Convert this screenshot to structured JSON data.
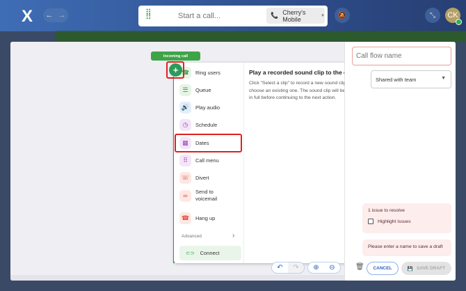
{
  "header": {
    "logo": "X",
    "back": "←",
    "forward": "→",
    "call_placeholder": "Start a call...",
    "line_label": "Cherry's Mobile",
    "avatar_initials": "CK"
  },
  "canvas": {
    "incoming_call": "Incoming call",
    "add": "+"
  },
  "menu": {
    "items": [
      {
        "label": "Ring users",
        "icon": "ring-users-icon",
        "glyph": "☎",
        "bg": "#e6f4e6",
        "color": "#2e9a4a"
      },
      {
        "label": "Queue",
        "icon": "queue-icon",
        "glyph": "☰",
        "bg": "#e6f4e6",
        "color": "#2e9a4a"
      },
      {
        "label": "Play audio",
        "icon": "speaker-icon",
        "glyph": "🔊",
        "bg": "#e3eefc",
        "color": "#2e62c0"
      },
      {
        "label": "Schedule",
        "icon": "clock-icon",
        "glyph": "◷",
        "bg": "#f2e6f7",
        "color": "#9a3cb8"
      },
      {
        "label": "Dates",
        "icon": "calendar-icon",
        "glyph": "▦",
        "bg": "#f2e6f7",
        "color": "#9a3cb8"
      },
      {
        "label": "Call menu",
        "icon": "dialpad-icon",
        "glyph": "⠿",
        "bg": "#f2e6f7",
        "color": "#9a3cb8"
      },
      {
        "label": "Divert",
        "icon": "divert-icon",
        "glyph": "☏",
        "bg": "#fde8e4",
        "color": "#e04a3a"
      },
      {
        "label": "Send to voicemail",
        "icon": "voicemail-icon",
        "glyph": "∞",
        "bg": "#fde8e4",
        "color": "#e04a3a"
      },
      {
        "label": "Hang up",
        "icon": "hang-up-icon",
        "glyph": "☎",
        "bg": "#fde8e4",
        "color": "#e04a3a"
      }
    ],
    "advanced": "Advanced",
    "connect": "Connect",
    "description_title": "Play a recorded sound clip to the caller",
    "description_body": "Click \"Select a clip\" to record a new sound clip or choose an existing one. The sound clip will be played in full before continuing to the next action."
  },
  "panel": {
    "name_placeholder": "Call flow name",
    "share": "Shared with team",
    "issues": "1 issue to resolve",
    "highlight": "Highlight issues",
    "warning": "Please enter a name to save a draft",
    "cancel": "CANCEL",
    "save": "SAVE DRAFT"
  }
}
